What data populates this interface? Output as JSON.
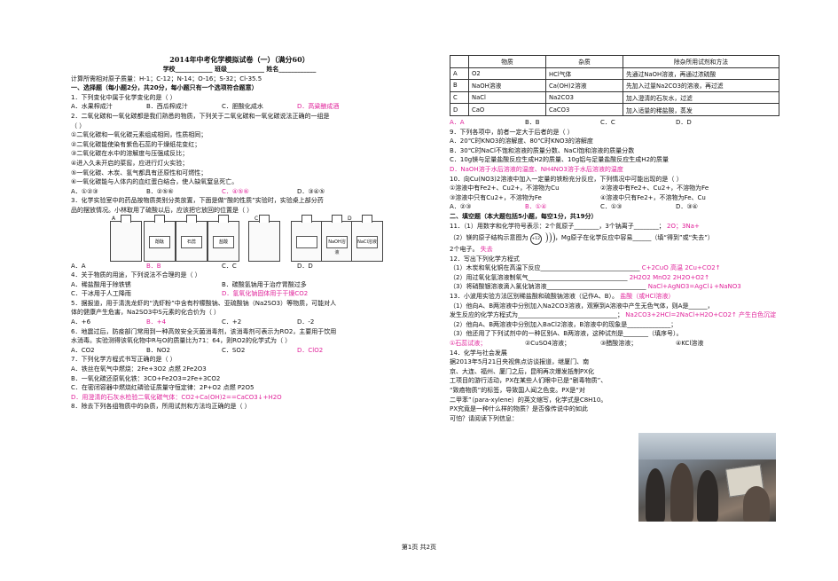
{
  "left": {
    "title": "2014年中考化学模拟试卷（一）（满分60）",
    "info": "学校____________ 班级____________ 姓名____________",
    "atomic_mass": "计算所需相对原子质量：H-1；C-12；N-14；O-16；S-32；Cl-35.5",
    "section1": "一、选择题（每小题2分，共20分，每小题只有一个选项符合题意）",
    "q1": "1．下列变化中属于化学变化的是（    ）",
    "q1_opts": [
      "A．水果榨成汁",
      "B．西瓜榨成汁",
      "C．胆酸化成水",
      "D．高粱酿成酒"
    ],
    "q2": "2．二氧化碳和一氧化碳都是我们熟悉的物质，下列关于二氧化碳和一氧化碳说法正确的一组是",
    "q2b": "（    ）",
    "q2_items": [
      "①二氧化碳和一氧化碳元素组成相同，性质相同；",
      "②二氧化碳能使染有紫色石蕊的干燥纸花变红；",
      "③二氧化碳在水中的溶解度与压强成反比；",
      "④进入久未开启的菜窖，应进行灯火实验；",
      "⑤一氧化碳、木炭、氢气都具有还原性和可燃性；",
      "⑥一氧化碳能与人体内的血红蛋白结合，使人缺氧窒息死亡。"
    ],
    "q2_opts": [
      "A．①②③",
      "B．②⑤⑥",
      "C．④⑤⑥",
      "D．③④⑤"
    ],
    "q3": "3．化学实验室中的药品按物质类别分类放置，下面是做“酸的性质”实验时，实验桌上部分药",
    "q3b": "品的摆放情况。小林取用了硫酸以后，应该把它放回的位置是（    ）",
    "bottles": [
      "酚酞",
      "石蕊",
      "盐酸",
      "",
      "",
      "NaOH溶液",
      "NaCl溶液"
    ],
    "q3_opts": [
      "A．A",
      "B．B",
      "C．C",
      "D．D"
    ],
    "q4": "4．关于物质的用途，下列说法不合理的是（    ）",
    "q4_opts": [
      "A．稀盐酸用于除铁锈",
      "B．碳酸氢钠用于治疗胃酸过多",
      "C．干冰用于人工降雨",
      "D．氢氧化钠固体用于干燥CO2"
    ],
    "q5": "5．据报道，用于清洗龙虾的“洗虾粉”中含有柠檬酸钠、亚硫酸钠（Na2SO3）等物质，可能对人",
    "q5b": "体的健康产生危害，Na2SO3中S元素的化合价为（    ）",
    "q5_opts": [
      "A．+6",
      "B．+4",
      "C．+2",
      "D．-2"
    ],
    "q6": "6．地震过后，防疫部门常用到一种高效安全灭菌消毒剂，该消毒剂可表示为RO2，主要用于饮用",
    "q6b": "水消毒。实验测得该氧化物中R与O的质量比为71：64，则RO2的化学式为（    ）",
    "q6_opts": [
      "A．CO2",
      "B．NO2",
      "C．SO2",
      "D．ClO2"
    ],
    "q7": "7．下列化学方程式书写正确的是（    ）",
    "q7_items": [
      "A．铁丝在氧气中燃烧：2Fe+3O2 点燃 2Fe2O3",
      "B．一氧化碳还原氧化铁：3CO+Fe2O3=2Fe+3CO2",
      "C．在密闭容器中燃烧红磷验证质量守恒定律：2P+O2 点燃 P2O5",
      "D．用澄清的石灰水检验二氧化碳气体：CO2+Ca(OH)2==CaCO3↓+H2O"
    ],
    "q8": "8．除去下列各组物质中的杂质，所用试剂和方法均正确的是（    ）"
  },
  "right": {
    "table_head": [
      "",
      "物质",
      "杂质",
      "除杂所用试剂和方法"
    ],
    "table_rows": [
      [
        "A",
        "O2",
        "HCl气体",
        "先通过NaOH溶液，再通过浓硫酸"
      ],
      [
        "B",
        "NaOH溶液",
        "Ca(OH)2溶液",
        "先加入过量Na2CO3的溶液，再过滤"
      ],
      [
        "C",
        "NaCl",
        "Na2CO3",
        "加入澄清的石灰水，过滤"
      ],
      [
        "D",
        "CaO",
        "CaCO3",
        "加入适量的稀盐酸，蒸发"
      ]
    ],
    "q8_opts": [
      "A．A",
      "B．B",
      "C．C",
      "D．D"
    ],
    "q9": "9．下列各项中，前者一定大于后者的是（    ）",
    "q9_items": [
      "A．20℃时KNO3的溶解度、80℃时KNO3的溶解度",
      "B．30℃时NaCl不饱和溶液的质量分数、NaCl饱和溶液的质量分数",
      "C．10g镁与足量盐酸反应生成H2的质量、10g铝与足量盐酸反应生成H2的质量",
      "D．NaOH溶于水后溶液的温度、NH4NO3溶于水后溶液的温度"
    ],
    "q10": "10．向Cu(NO3)2溶液中加入一定量的铁粉充分反应，下列情况中可能出现的是（    ）",
    "q10_items": [
      [
        "①溶液中有Fe2+、Cu2+，不溶物为Cu",
        "②溶液中有Fe2+、Cu2+，不溶物为Fe"
      ],
      [
        "③溶液中只有Cu2+，不溶物为Fe",
        "④溶液中只有Fe2+，不溶物为Fe、Cu"
      ]
    ],
    "q10_opts": [
      "A．②③",
      "B．①④",
      "C．①③",
      "D．③④"
    ],
    "section2": "二、填空题（本大题包括5小题，每空1分，共19分）",
    "q11": "11．（1）用数字和化学符号表示：2个氮原子________，3个钠离子________；",
    "q11_ans": "2O；3Na+",
    "q11b": "（2）镁的原子结构示意图为",
    "q11c": "，Mg原子在化学反应中容易______（填“得到”或“失去”）",
    "q11d": "2个电子。",
    "q11d_ans": "失去",
    "q12": "12．写出下列化学方程式",
    "q12_items": [
      [
        "（1）木炭和氧化铜在高温下反应________________________________",
        "C+2CuO 高温 2Cu+CO2↑"
      ],
      [
        "（2）用过氧化氢溶液制氧气________________________________",
        "2H2O2 MnO2 2H2O+O2↑"
      ],
      [
        "（3）将硝酸银溶液滴入氯化钠溶液________________________________",
        "NaCl+AgNO3=AgCl↓+NaNO3"
      ]
    ],
    "q13": "13．小波用实验方法区别稀盐酸和硫酸钠溶液（记作A、B）。",
    "q13_ans": "盐酸（或HCl溶液）",
    "q13a": "（1）他向A、B两溶液中分别加入Na2CO3溶液，观察到A溶液中产生无色气体，则A是______，",
    "q13b": "发生反应的化学方程式为________________________________；",
    "q13b_ans": "Na2CO3+2HCl=2NaCl+H2O+CO2↑ 产生白色沉淀",
    "q13c": "（2）他向A、B两溶液中分别加入BaCl2溶液，B溶液中的现象是______________；",
    "q13d": "（3）他还用了下列试剂中的一种区别A、B两溶液，这种试剂是________（填序号）。",
    "q13_opts": [
      "①石蕊试液；",
      "②CuSO4溶液；",
      "③醋酸溶液；",
      "④KCl溶液"
    ],
    "q14": "14．化学与社会发展",
    "q14_lines": [
      "据2013年5月21日央视焦点访谈报道，继厦门、南",
      "京、大连、福州、厦门之后，昆明再次爆发抵制PX化",
      "工项目的游行活动，PX在某些人们眼中已是“剧毒物质”、",
      "“致癌物质”的标签，导致国人闻之色变。PX是“对",
      "二甲苯”（para-xylene）的英文缩写，化学式是C8H10。",
      "PX究竟是一种什么样的物质？是否像传说中的如此",
      "可怕？请阅读下列信息："
    ]
  },
  "footer": "第1页 共2页"
}
